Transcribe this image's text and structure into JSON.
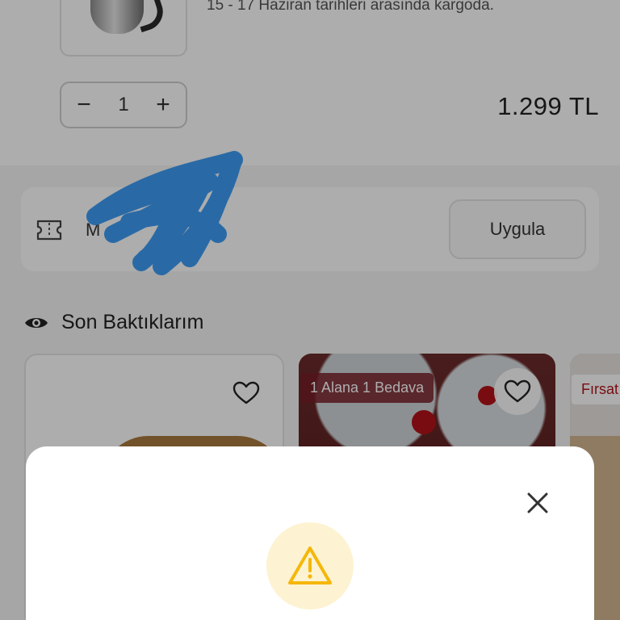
{
  "cart_item": {
    "delivery_text": "15 - 17 Haziran tarihleri arasında kargoda.",
    "quantity": "1",
    "decrease_symbol": "−",
    "increase_symbol": "+",
    "price": "1.299 TL"
  },
  "coupon": {
    "icon": "ticket-icon",
    "label_visible": "M",
    "apply_label": "Uygula"
  },
  "recently_viewed": {
    "icon": "eye-icon",
    "title": "Son Baktıklarım",
    "items": [
      {
        "badge": "",
        "favorite_icon": "heart-icon"
      },
      {
        "badge": "1 Alana 1 Bedava",
        "favorite_icon": "heart-icon"
      },
      {
        "badge": "Fırsat",
        "favorite_icon": ""
      }
    ]
  },
  "modal": {
    "close_icon": "close-icon",
    "status_icon": "warning-icon",
    "accent_color": "#f5b70a",
    "accent_bg": "#fdf3d2"
  },
  "annotation": {
    "scribble_color": "#3d9cf5"
  },
  "colors": {
    "overlay": "rgba(0,0,0,0.32)",
    "badge_red": "#b3121a"
  }
}
